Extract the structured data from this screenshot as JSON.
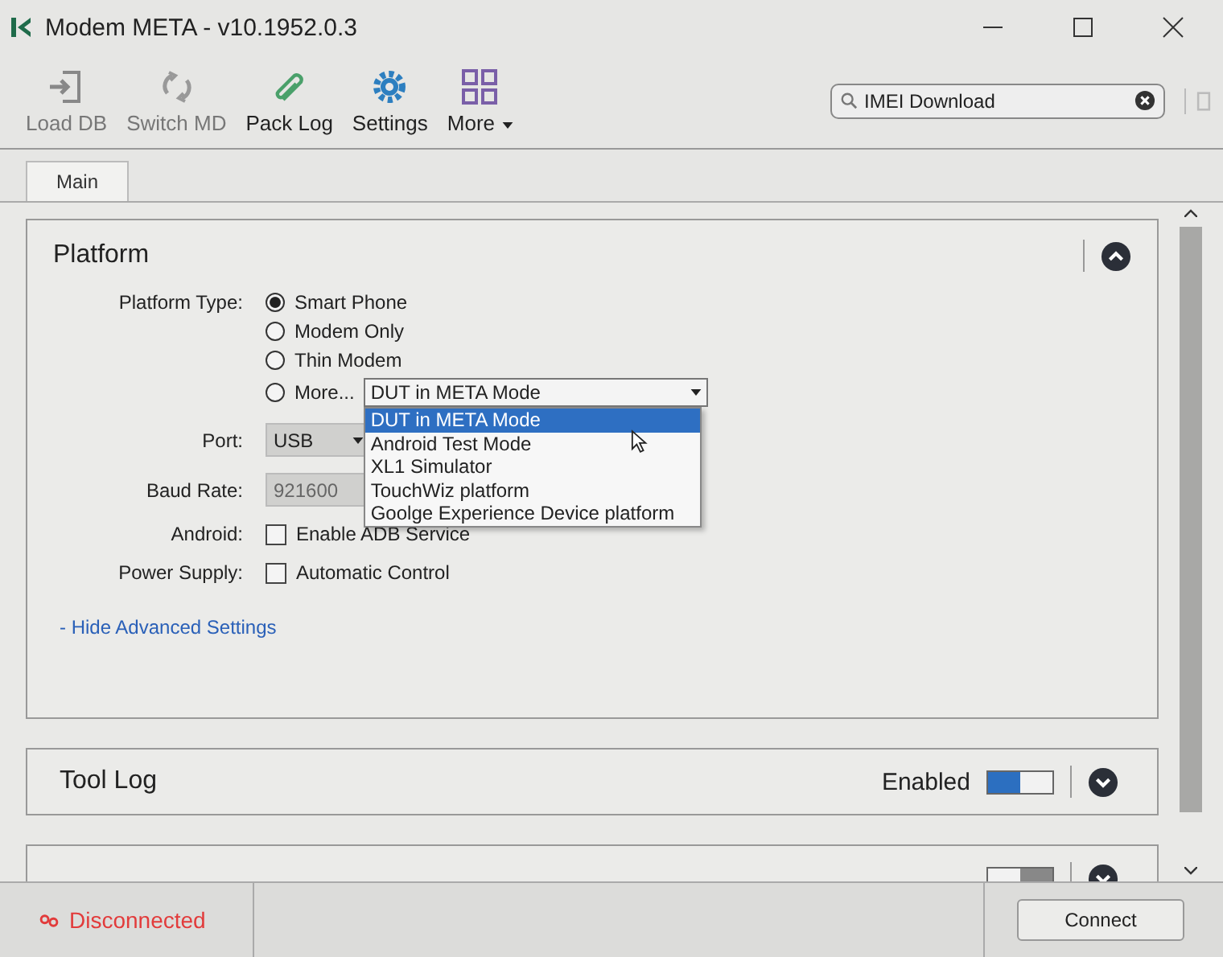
{
  "window": {
    "title": "Modem META - v10.1952.0.3"
  },
  "toolbar": [
    {
      "label": "Load DB",
      "disabled": true,
      "kind": "load"
    },
    {
      "label": "Switch MD",
      "disabled": true,
      "kind": "switch"
    },
    {
      "label": "Pack Log",
      "disabled": false,
      "kind": "clip"
    },
    {
      "label": "Settings",
      "disabled": false,
      "kind": "gear"
    },
    {
      "label": "More",
      "disabled": false,
      "kind": "grid"
    }
  ],
  "search": {
    "value": "IMEI Download"
  },
  "tabs": [
    {
      "label": "Main",
      "selected": true
    }
  ],
  "platform": {
    "title": "Platform",
    "expanded": true,
    "type_label": "Platform Type:",
    "types": [
      {
        "label": "Smart Phone",
        "selected": true
      },
      {
        "label": "Modem Only",
        "selected": false
      },
      {
        "label": "Thin Modem",
        "selected": false
      },
      {
        "label": "More...",
        "selected": false
      }
    ],
    "more_select": {
      "value": "DUT in META Mode",
      "options": [
        {
          "label": "DUT in META Mode",
          "selected": true
        },
        {
          "label": "Android Test Mode",
          "selected": false
        },
        {
          "label": "XL1 Simulator",
          "selected": false
        },
        {
          "label": "TouchWiz platform",
          "selected": false
        },
        {
          "label": "Goolge Experience Device platform",
          "selected": false
        }
      ]
    },
    "port_label": "Port:",
    "port": "USB",
    "baud_label": "Baud Rate:",
    "baud": "921600",
    "android_label": "Android:",
    "android": {
      "label": "Enable ADB Service",
      "checked": false
    },
    "power_label": "Power Supply:",
    "power": {
      "label": "Automatic Control",
      "checked": false
    },
    "advanced_link": "- Hide Advanced Settings"
  },
  "panels": [
    {
      "title": "Tool Log",
      "state": "Enabled",
      "on": true
    },
    {
      "on": false
    }
  ],
  "status": {
    "text": "Disconnected",
    "button": "Connect"
  }
}
